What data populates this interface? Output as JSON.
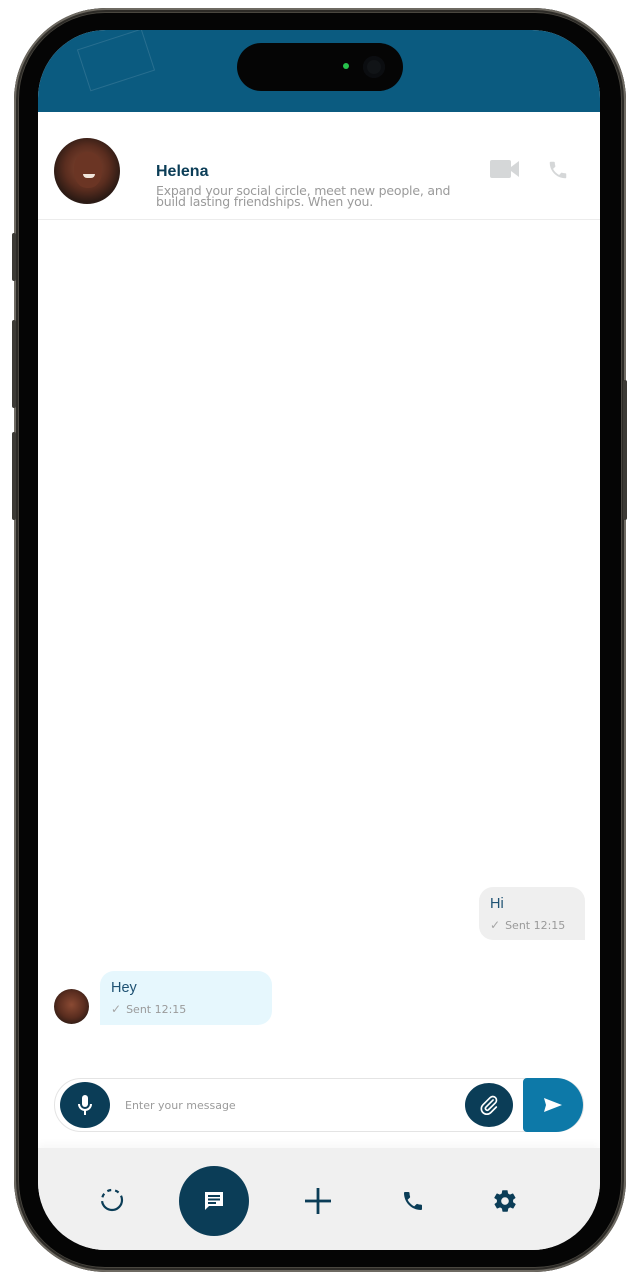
{
  "colors": {
    "brand_dark": "#0b3d57",
    "brand_header": "#0b5b80",
    "send_accent": "#0d79a8",
    "sent_bubble": "#efefef",
    "received_bubble": "#e6f7fd"
  },
  "contact": {
    "name": "Helena",
    "status": "Expand your social circle, meet new people, and build lasting friendships. When you.",
    "avatar_icon": "avatar-photo",
    "actions": [
      {
        "name": "video-call",
        "icon": "video-camera-icon"
      },
      {
        "name": "voice-call",
        "icon": "phone-icon"
      }
    ]
  },
  "messages": [
    {
      "direction": "sent",
      "text": "Hi",
      "status_icon": "check-icon",
      "status": "Sent 12:15"
    },
    {
      "direction": "received",
      "text": "Hey",
      "status_icon": "check-icon",
      "status": "Sent 12:15"
    }
  ],
  "composer": {
    "placeholder": "Enter your message",
    "value": "",
    "mic_icon": "microphone-icon",
    "attach_icon": "paperclip-icon",
    "send_icon": "send-icon"
  },
  "bottom_nav": {
    "items": [
      {
        "name": "status",
        "icon": "dashed-circle-icon",
        "active": false
      },
      {
        "name": "chats",
        "icon": "chat-bubble-icon",
        "active": true
      },
      {
        "name": "new",
        "icon": "plus-icon",
        "active": false
      },
      {
        "name": "calls",
        "icon": "phone-icon",
        "active": false
      },
      {
        "name": "settings",
        "icon": "gear-icon",
        "active": false
      }
    ]
  }
}
